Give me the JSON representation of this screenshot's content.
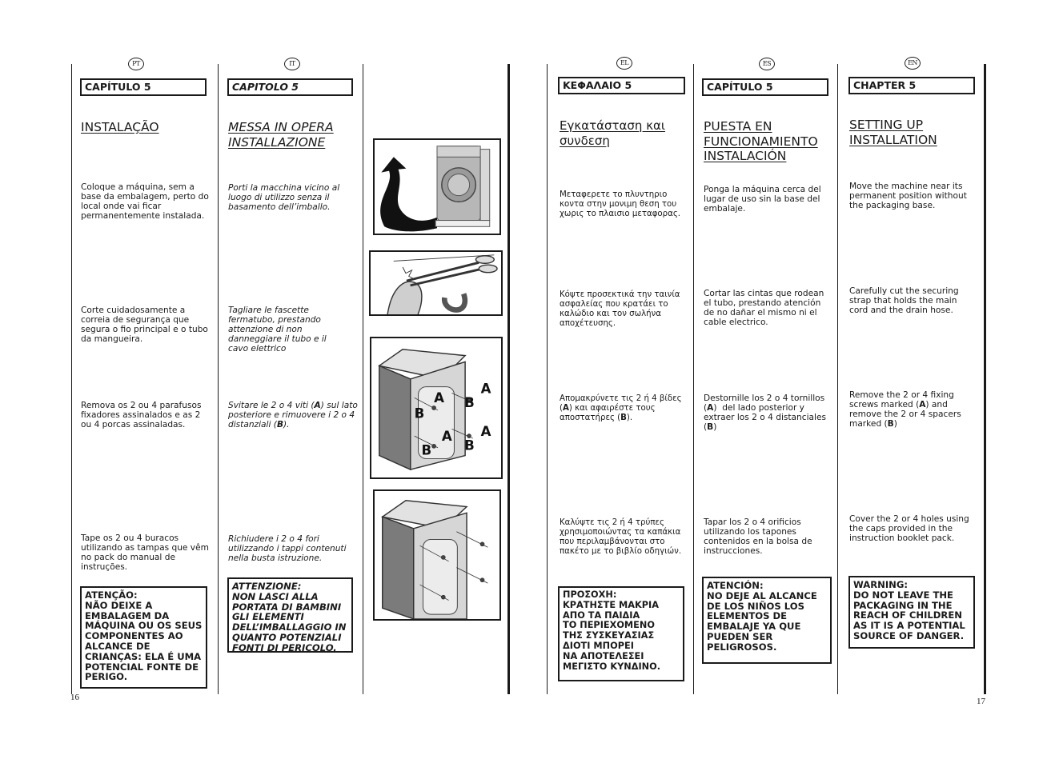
{
  "pages": {
    "left_number": "16",
    "right_number": "17"
  },
  "columns": {
    "pt": {
      "lang": "PT",
      "chapter": "CAPÍTULO 5",
      "title_lines": [
        "INSTALAÇÃO"
      ],
      "steps": [
        "Coloque a máquina, sem a base da embalagem, perto do local onde vai ficar permanentemente instalada.",
        "Corte cuidadosamente a correia de segurança que segura o fio principal e o tubo da mangueira.",
        "Remova os 2 ou 4 parafusos fixadores assinalados e as 2 ou 4 porcas assinaladas.",
        "Tape os 2 ou 4 buracos utilizando as tampas que vêm no pack do manual de instruções."
      ],
      "warning": "ATENÇÃO:\nNÃO DEIXE A EMBALAGEM DA MÁQUINA OU OS SEUS COMPONENTES AO ALCANCE DE CRIANÇAS: ELA É UMA POTENCIAL FONTE DE PERIGO."
    },
    "it": {
      "lang": "IT",
      "chapter": "CAPITOLO 5",
      "title_lines": [
        "MESSA IN OPERA",
        "INSTALLAZIONE"
      ],
      "steps": [
        "Porti la macchina vicino al luogo di utilizzo senza il basamento dell’imballo.",
        "Tagliare le fascette fermatubo, prestando attenzione di non danneggiare il tubo e il cavo elettrico",
        "Svitare le 2 o 4 viti (A) sul lato posteriore e rimuovere i 2 o 4 distanziali (B).",
        "Richiudere i 2 o 4 fori utilizzando i tappi contenuti nella busta istruzione."
      ],
      "warning": "ATTENZIONE:\nNON LASCI ALLA PORTATA DI BAMBINI GLI ELEMENTI DELL’IMBALLAGGIO IN QUANTO POTENZIALI FONTI DI PERICOLO."
    },
    "el": {
      "lang": "EL",
      "chapter": "ΚΕΦΑΛΑΙΟ 5",
      "title_lines": [
        "Εγκατάσταση και",
        "συνδεση"
      ],
      "steps": [
        "Μεταφερετε το πλυντηριο κοντα στην μονιμη θεση του χωρις το πλαισιο μεταφορας.",
        "Κόψτε προσεκτικά την ταινία ασφαλείας που κρατάει το καλώδιο και τον σωλήνα αποχέτευσης.",
        "Απομακρύνετε τις 2 ή 4 βίδες (A) και αφαιρέστε τους αποστατήρες (B).",
        "Καλύψτε τις 2 ή 4 τρύπες χρησιμοποιώντας τα καπάκια που περιλαμβάνονται στο πακέτο με το βιβλίο οδηγιών."
      ],
      "warning": "ΠΡΟΣΟΧΗ:\nΚΡΑΤΗΣΤΕ ΜΑΚΡΙΑ\nΑΠΟ ΤΑ ΠΑΙΔΙΑ\nΤΟ ΠΕΡΙΕΧΟΜΕΝΟ\nΤΗΣ ΣΥΣΚΕΥΑΣΙΑΣ\nΔΙΟΤΙ ΜΠΟΡΕΙ\nΝΑ ΑΠΟΤΕΛΕΣΕΙ\nΜΕΓΙΣΤΟ ΚΥΝΔΙΝΟ."
    },
    "es": {
      "lang": "ES",
      "chapter": "CAPÍTULO 5",
      "title_lines": [
        "PUESTA EN",
        "FUNCIONAMIENTO",
        "INSTALACIÓN"
      ],
      "steps": [
        "Ponga la máquina cerca del lugar de uso sin la base del embalaje.",
        "Cortar las cintas que rodean el tubo, prestando atención de no dañar el mismo ni el cable electrico.",
        "Destornille los 2 o 4 tornillos (A)  del lado posterior y extraer los 2 o 4 distanciales (B)",
        "Tapar los 2 o 4 orificios utilizando los tapones contenidos en la bolsa de instrucciones."
      ],
      "warning": "ATENCIÓN:\nNO DEJE AL ALCANCE DE LOS NIÑOS LOS ELEMENTOS DE EMBALAJE YA QUE PUEDEN SER PELIGROSOS."
    },
    "en": {
      "lang": "EN",
      "chapter": "CHAPTER 5",
      "title_lines": [
        "SETTING UP",
        "INSTALLATION"
      ],
      "steps": [
        "Move the machine near its permanent position without the packaging base.",
        "Carefully cut the securing strap that holds the main cord and the drain hose.",
        "Remove the 2 or 4 fixing screws marked (A) and remove the 2 or 4 spacers marked (B)",
        "Cover the 2 or 4 holes using the caps provided in the instruction booklet pack."
      ],
      "warning": "WARNING:\nDO NOT LEAVE THE PACKAGING IN THE REACH OF CHILDREN AS IT IS A POTENTIAL SOURCE OF DANGER."
    }
  },
  "figures": {
    "fig1": {
      "description": "washing-machine-lifted-off-packaging-base",
      "icon": "curved-arrow-icon"
    },
    "fig2": {
      "description": "scissors-cutting-strap-on-hose",
      "icon": "scissors-icon"
    },
    "fig3": {
      "description": "rear-view-screws-and-spacers",
      "labels": [
        "A",
        "A",
        "A",
        "A",
        "B",
        "B",
        "B",
        "B"
      ]
    },
    "fig4": {
      "description": "rear-view-holes-to-cover"
    }
  }
}
